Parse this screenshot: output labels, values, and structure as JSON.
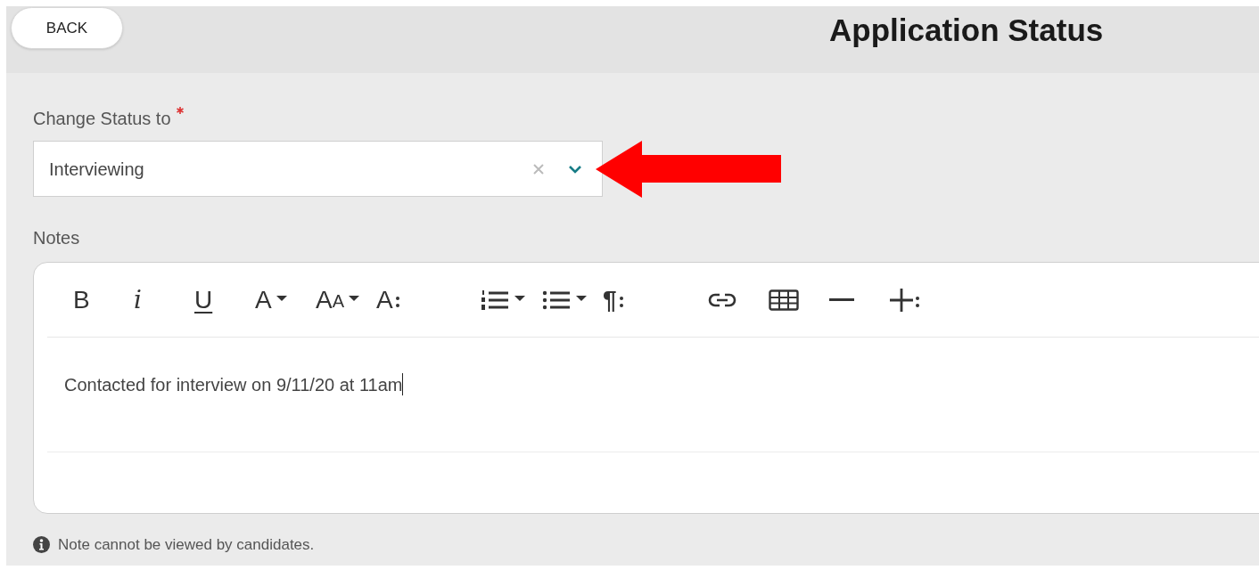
{
  "header": {
    "back_button": "BACK",
    "title": "Application Status"
  },
  "status_field": {
    "label": "Change Status to",
    "required": true,
    "value": "Interviewing",
    "clearable": true
  },
  "notes": {
    "label": "Notes",
    "toolbar": [
      {
        "kind": "bold",
        "label": "B"
      },
      {
        "kind": "italic",
        "label": "i"
      },
      {
        "kind": "underline",
        "label": "U"
      },
      {
        "kind": "letter",
        "label": "A",
        "dropdown": true
      },
      {
        "kind": "size",
        "label": "AA",
        "dropdown": true
      },
      {
        "kind": "letter",
        "label": "A",
        "more": true
      },
      {
        "kind": "numbered",
        "dropdown": true
      },
      {
        "kind": "bulleted",
        "dropdown": true
      },
      {
        "kind": "paragraph",
        "label": "¶",
        "more": true
      },
      {
        "kind": "link"
      },
      {
        "kind": "table"
      },
      {
        "kind": "rule"
      },
      {
        "kind": "insert",
        "more": true
      }
    ],
    "content": "Contacted for interview on 9/11/20 at 11am",
    "cursor": true
  },
  "hint": "Note cannot be viewed by candidates."
}
